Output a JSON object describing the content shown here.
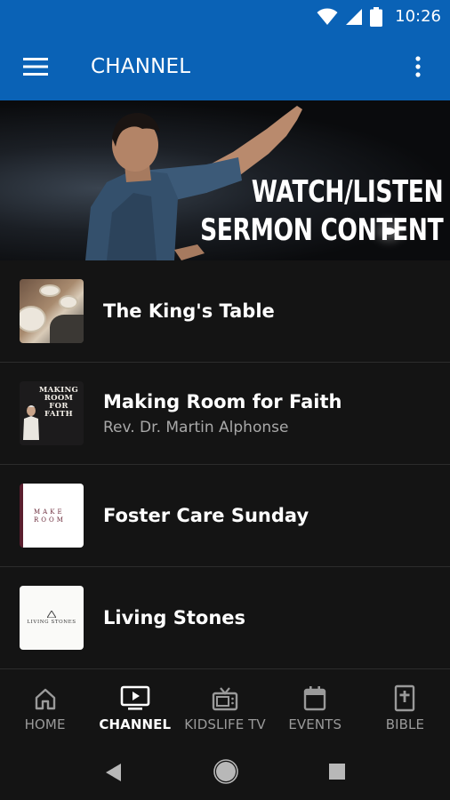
{
  "status_bar": {
    "time": "10:26",
    "icons": [
      "wifi-icon",
      "cell-signal-icon",
      "battery-icon"
    ]
  },
  "app_bar": {
    "title": "CHANNEL",
    "menu_icon": "hamburger-menu-icon",
    "more_icon": "more-vertical-icon"
  },
  "hero": {
    "line1": "WATCH/LISTEN",
    "line2": "SERMON CONTENT"
  },
  "channels": [
    {
      "title": "The King's Table",
      "subtitle": ""
    },
    {
      "title": "Making Room for Faith",
      "subtitle": "Rev. Dr. Martin Alphonse",
      "thumb_text": "MAKING ROOM FOR FAITH"
    },
    {
      "title": "Foster Care Sunday",
      "subtitle": "",
      "thumb_text": "MAKE ROOM"
    },
    {
      "title": "Living Stones",
      "subtitle": "",
      "thumb_text": "LIVING STONES"
    }
  ],
  "bottom_nav": {
    "items": [
      {
        "label": "HOME",
        "icon": "home-icon",
        "active": false
      },
      {
        "label": "CHANNEL",
        "icon": "tv-play-icon",
        "active": true
      },
      {
        "label": "KIDSLIFE TV",
        "icon": "tv-antenna-icon",
        "active": false
      },
      {
        "label": "EVENTS",
        "icon": "calendar-icon",
        "active": false
      },
      {
        "label": "BIBLE",
        "icon": "bible-icon",
        "active": false
      }
    ]
  },
  "colors": {
    "primary": "#0a62b6",
    "background": "#141414",
    "divider": "#2c2c2c",
    "subtitle": "#a8a8a8"
  }
}
